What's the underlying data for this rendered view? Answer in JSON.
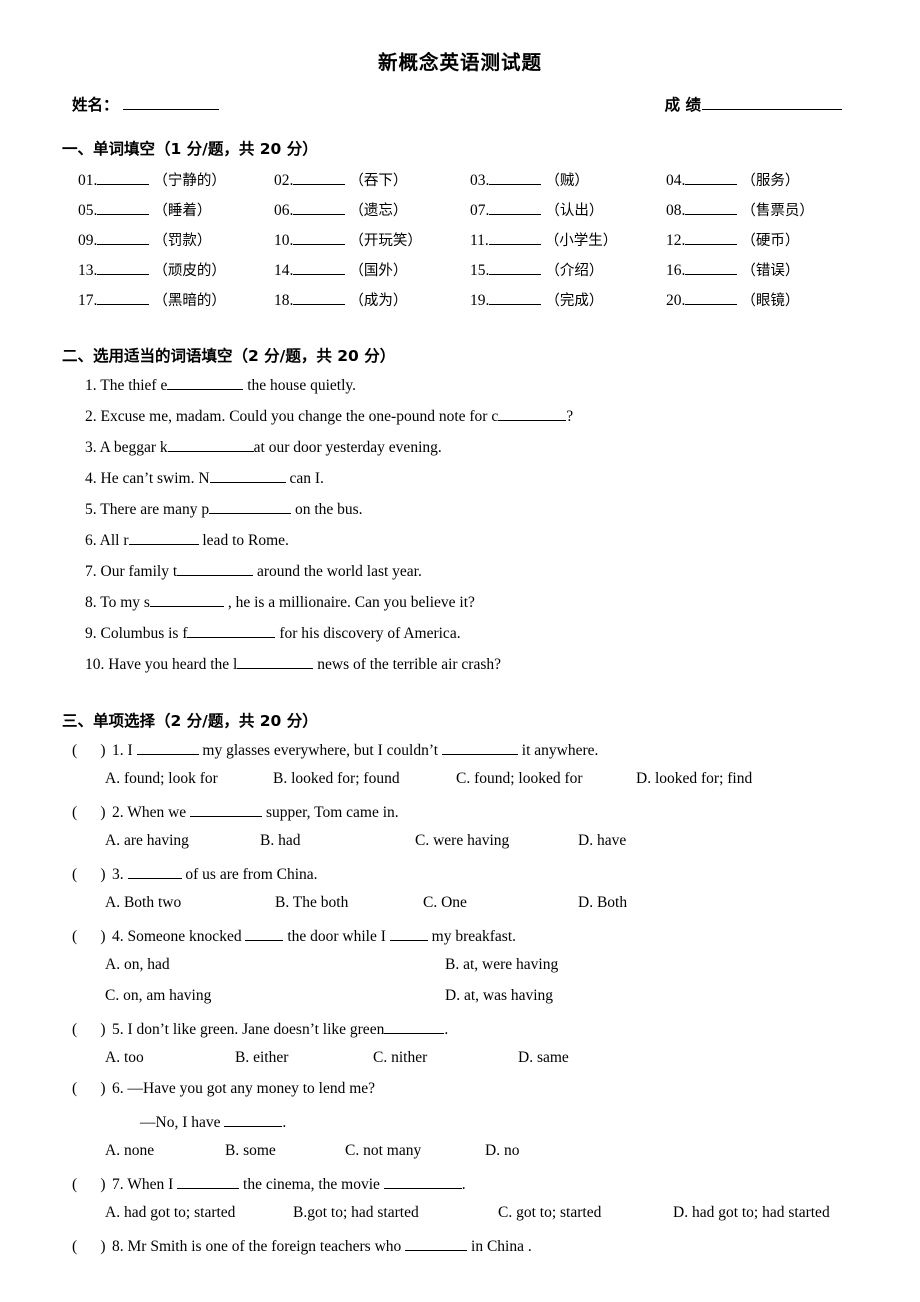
{
  "document": {
    "title": "新概念英语测试题",
    "name_label": "姓名：",
    "score_label": "成 绩"
  },
  "section1": {
    "heading": "一、单词填空（1 分/题，共 20 分）",
    "items": [
      {
        "num": "01.",
        "gloss": "（宁静的）"
      },
      {
        "num": "02.",
        "gloss": "（吞下）"
      },
      {
        "num": "03.",
        "gloss": "（贼）"
      },
      {
        "num": "04.",
        "gloss": "（服务）"
      },
      {
        "num": "05.",
        "gloss": "（睡着）"
      },
      {
        "num": "06.",
        "gloss": "（遗忘）"
      },
      {
        "num": "07.",
        "gloss": "（认出）"
      },
      {
        "num": "08.",
        "gloss": "（售票员）"
      },
      {
        "num": "09.",
        "gloss": "（罚款）"
      },
      {
        "num": "10.",
        "gloss": "（开玩笑）"
      },
      {
        "num": "11.",
        "gloss": "（小学生）"
      },
      {
        "num": "12.",
        "gloss": "（硬币）"
      },
      {
        "num": "13.",
        "gloss": "（顽皮的）"
      },
      {
        "num": "14.",
        "gloss": "（国外）"
      },
      {
        "num": "15.",
        "gloss": "（介绍）"
      },
      {
        "num": "16.",
        "gloss": "（错误）"
      },
      {
        "num": "17.",
        "gloss": "（黑暗的）"
      },
      {
        "num": "18.",
        "gloss": "（成为）"
      },
      {
        "num": "19.",
        "gloss": "（完成）"
      },
      {
        "num": "20.",
        "gloss": "（眼镜）"
      }
    ]
  },
  "section2": {
    "heading": "二、选用适当的词语填空（2 分/题，共 20 分）",
    "items": [
      {
        "num": "1.",
        "before": " The thief e",
        "after": " the house quietly.",
        "blank_width": 76
      },
      {
        "num": "2.",
        "before": " Excuse me, madam. Could you change the one-pound note for c",
        "after": "?",
        "blank_width": 68
      },
      {
        "num": "3.",
        "before": " A beggar k",
        "after": "at our door yesterday evening.",
        "blank_width": 86
      },
      {
        "num": "4.",
        "before": " He can’t swim. N",
        "after": " can I.",
        "blank_width": 76
      },
      {
        "num": "5.",
        "before": " There are many p",
        "after": " on the bus.",
        "blank_width": 82
      },
      {
        "num": "6.",
        "before": " All r",
        "after": " lead to Rome.",
        "blank_width": 70
      },
      {
        "num": "7.",
        "before": " Our family t",
        "after": " around the world last year.",
        "blank_width": 76
      },
      {
        "num": "8.",
        "before": " To my s",
        "after": " , he is a millionaire. Can you believe it?",
        "blank_width": 74
      },
      {
        "num": "9.",
        "before": " Columbus is f",
        "after": " for his discovery of America.",
        "blank_width": 88
      },
      {
        "num": "10.",
        "before": " Have you heard the l",
        "after": " news of the terrible air crash?",
        "blank_width": 76
      }
    ]
  },
  "section3": {
    "heading": "三、单项选择（2 分/题，共 20 分）",
    "paren": "(      )",
    "questions": [
      {
        "num": "1.",
        "stem_parts": [
          " I ",
          " my glasses everywhere, but I couldn’t ",
          " it anywhere."
        ],
        "blank_widths": [
          62,
          76
        ],
        "layout": "row",
        "options": [
          "A. found; look for",
          "B. looked for; found",
          "C. found; looked for",
          "D. looked for; find"
        ],
        "option_widths": [
          168,
          183,
          180,
          160
        ]
      },
      {
        "num": "2.",
        "stem_parts": [
          " When we ",
          " supper, Tom came in."
        ],
        "blank_widths": [
          72
        ],
        "layout": "row",
        "options": [
          "A. are having",
          "B. had",
          "C. were having",
          "D. have"
        ],
        "option_widths": [
          155,
          155,
          163,
          120
        ]
      },
      {
        "num": "3.",
        "stem_parts": [
          " ",
          " of us are from China."
        ],
        "blank_widths": [
          54
        ],
        "layout": "row",
        "options": [
          "A. Both two",
          "B. The both",
          "C. One",
          "D. Both"
        ],
        "option_widths": [
          170,
          148,
          155,
          120
        ]
      },
      {
        "num": "4.",
        "stem_parts": [
          " Someone knocked ",
          " the door while I ",
          " my breakfast."
        ],
        "blank_widths": [
          38,
          38
        ],
        "layout": "grid",
        "options": [
          "A. on, had",
          "B. at, were having",
          "C. on, am having",
          "D. at, was having"
        ],
        "option_widths": [
          340,
          240,
          340,
          240
        ]
      },
      {
        "num": "5.",
        "stem_parts": [
          " I don’t like green. Jane doesn’t like green",
          "."
        ],
        "blank_widths": [
          60
        ],
        "layout": "row",
        "options": [
          "A. too",
          "B. either",
          "C. nither",
          "D. same"
        ],
        "option_widths": [
          130,
          138,
          145,
          120
        ]
      },
      {
        "num": "6.",
        "stem_parts": [
          " —Have you got any money to lend me?"
        ],
        "blank_widths": [],
        "layout": "row",
        "sub_line": {
          "before": "—No, I have ",
          "after": ".",
          "blank_width": 58
        },
        "options": [
          "A. none",
          "B. some",
          "C. not many",
          "D. no"
        ],
        "option_widths": [
          120,
          120,
          140,
          110
        ]
      },
      {
        "num": "7.",
        "stem_parts": [
          " When I ",
          " the cinema, the movie ",
          "."
        ],
        "blank_widths": [
          62,
          78
        ],
        "layout": "row",
        "options": [
          "A. had got to; started",
          "B.got to; had started",
          "C. got to; started",
          "D. had got to; had started"
        ],
        "option_widths": [
          188,
          205,
          175,
          205
        ]
      },
      {
        "num": "8.",
        "stem_parts": [
          " Mr Smith is one of the foreign teachers who ",
          " in China ."
        ],
        "blank_widths": [
          62
        ],
        "layout": "row",
        "options": [],
        "option_widths": []
      }
    ]
  }
}
